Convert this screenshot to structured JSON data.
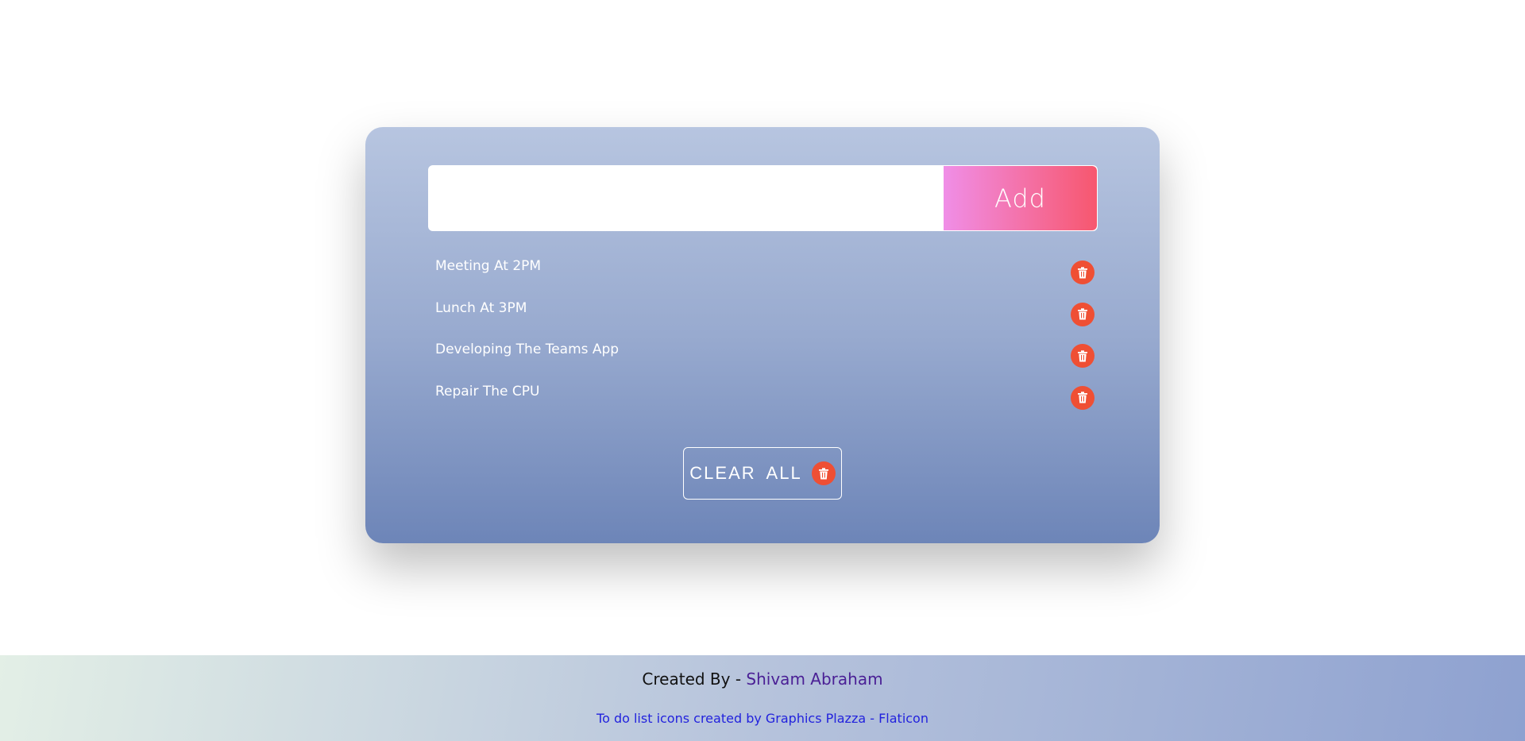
{
  "todo": {
    "input_placeholder": "",
    "input_value": "",
    "add_label": "Add",
    "tasks": [
      {
        "text": "Meeting At 2PM"
      },
      {
        "text": "Lunch At 3PM"
      },
      {
        "text": "Developing The Teams App"
      },
      {
        "text": "Repair The CPU"
      }
    ],
    "clear_all_label": "CLEAR  ALL"
  },
  "footer": {
    "created_by_prefix": "Created By - ",
    "author": "Shivam Abraham",
    "attribution": "To do list icons created by Graphics Plazza - Flaticon"
  },
  "colors": {
    "delete_icon_bg": "#ef4f34",
    "add_gradient_start": "#f08ee7",
    "add_gradient_end": "#f7576e",
    "author_color": "#4a1f95",
    "attribution_color": "#2222dd"
  },
  "icons": {
    "delete": "trash-icon"
  }
}
